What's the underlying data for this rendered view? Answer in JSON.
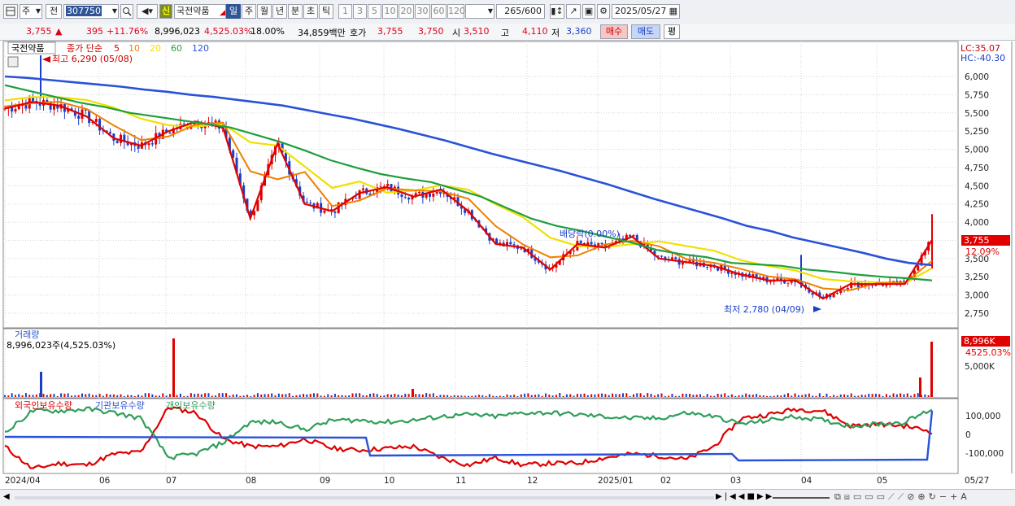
{
  "toolbar": {
    "market": "주",
    "prev": "전",
    "code": "307750",
    "name_badge": "신",
    "name": "국전약품",
    "periods": [
      "일",
      "주",
      "월",
      "년",
      "분",
      "초",
      "틱"
    ],
    "active_period": "일",
    "intervals": [
      "1",
      "3",
      "5",
      "10",
      "20",
      "30",
      "60",
      "120"
    ],
    "count": "265",
    "count_total": "/600",
    "date": "2025/05/27"
  },
  "quote": {
    "price": "3,755",
    "change_arrow": "▲",
    "change": "395",
    "change_pct": "+11.76%",
    "volume": "8,996,023",
    "volume_ratio": "4,525.03%",
    "turnover_pct": "18.00%",
    "amount": "34,859백만",
    "bid_label": "호가",
    "ask": "3,755",
    "bid": "3,750",
    "open_label": "시",
    "open": "3,510",
    "high_label": "고",
    "high": "4,110",
    "low_label": "저",
    "low": "3,360",
    "buy": "매수",
    "sell": "매도",
    "eval": "평"
  },
  "price_panel": {
    "stock_label": "국전약품",
    "indicator_label": "종가 단순",
    "ma_labels": [
      "5",
      "10",
      "20",
      "60",
      "120"
    ],
    "ma_colors": [
      "#e00000",
      "#f08000",
      "#f0e000",
      "#1e9e3c",
      "#2a52d8"
    ],
    "lc": "LC:35.07",
    "hc": "HC:-40.30",
    "high_marker": "최고 6,290 (05/08)",
    "low_marker": "최저 2,780 (04/09)",
    "dividend_marker": "배당락(0.00%)",
    "current_price_tag": "3,755",
    "current_pct_tag": "12.09%"
  },
  "volume_panel": {
    "title": "거래량",
    "value": "8,996,023주(4,525.03%)",
    "tag_value": "8,996K",
    "tag_pct": "4525.03%",
    "axis_label": "5,000K"
  },
  "holdings_panel": {
    "titles": [
      "외국인보유수량",
      "기관보유수량",
      "개인보유수량"
    ],
    "colors": [
      "#e00000",
      "#2a52d8",
      "#2e9e5a"
    ],
    "axis_labels": [
      "100,000",
      "0",
      "-100,000"
    ]
  },
  "x_axis": [
    "2024/04",
    "06",
    "07",
    "08",
    "09",
    "10",
    "11",
    "12",
    "2025/01",
    "02",
    "03",
    "04",
    "05"
  ],
  "x_axis_right": "05/27",
  "chart_data": {
    "type": "line",
    "title": "국전약품 (307750) 일봉",
    "y_ticks": [
      6000,
      5750,
      5500,
      5250,
      5000,
      4750,
      4500,
      4250,
      4000,
      3750,
      3500,
      3250,
      3000,
      2750
    ],
    "ylim": [
      2570,
      6220
    ],
    "series": [
      {
        "name": "종가",
        "values": [
          5560,
          5650,
          5600,
          5450,
          5150,
          5050,
          5250,
          5380,
          5300,
          4050,
          5080,
          4250,
          4150,
          4400,
          4480,
          4350,
          4450,
          4150,
          3700,
          3650,
          3350,
          3700,
          3650,
          3800,
          3500,
          3450,
          3400,
          3280,
          3200,
          3200,
          2950,
          3150,
          3150,
          3150,
          3755
        ]
      },
      {
        "name": "120",
        "values": [
          6000,
          5980,
          5950,
          5920,
          5890,
          5860,
          5820,
          5790,
          5750,
          5720,
          5680,
          5640,
          5600,
          5540,
          5480,
          5420,
          5350,
          5280,
          5200,
          5120,
          5030,
          4940,
          4860,
          4780,
          4700,
          4610,
          4520,
          4420,
          4320,
          4230,
          4140,
          4050,
          3950,
          3880,
          3790,
          3720,
          3650,
          3580,
          3500,
          3440,
          3410
        ]
      },
      {
        "name": "60",
        "values": [
          5880,
          5800,
          5720,
          5640,
          5580,
          5500,
          5450,
          5400,
          5350,
          5300,
          5200,
          5100,
          4980,
          4850,
          4750,
          4660,
          4600,
          4550,
          4450,
          4350,
          4200,
          4050,
          3950,
          3880,
          3800,
          3720,
          3620,
          3560,
          3520,
          3440,
          3420,
          3400,
          3350,
          3320,
          3280,
          3250,
          3230,
          3200
        ]
      }
    ]
  }
}
